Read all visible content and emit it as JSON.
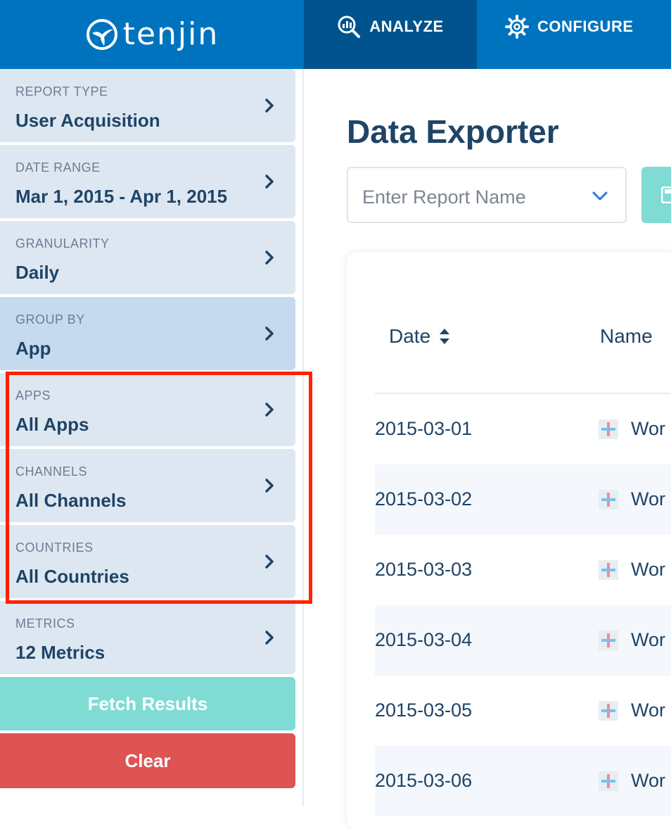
{
  "header": {
    "brand": "tenjin",
    "tabs": [
      {
        "label": "ANALYZE",
        "icon": "analyze-icon",
        "active": true
      },
      {
        "label": "CONFIGURE",
        "icon": "gear-icon",
        "active": false
      }
    ]
  },
  "sidebar": {
    "filters": [
      {
        "label": "REPORT TYPE",
        "value": "User Acquisition"
      },
      {
        "label": "DATE RANGE",
        "value": "Mar 1, 2015 - Apr 1, 2015"
      },
      {
        "label": "GRANULARITY",
        "value": "Daily"
      },
      {
        "label": "GROUP BY",
        "value": "App"
      },
      {
        "label": "APPS",
        "value": "All Apps"
      },
      {
        "label": "CHANNELS",
        "value": "All Channels"
      },
      {
        "label": "COUNTRIES",
        "value": "All Countries"
      },
      {
        "label": "METRICS",
        "value": "12 Metrics"
      }
    ],
    "fetch_label": "Fetch Results",
    "clear_label": "Clear"
  },
  "main": {
    "title": "Data Exporter",
    "report_name_placeholder": "Enter Report Name",
    "table": {
      "columns": [
        "Date",
        "Name"
      ],
      "rows": [
        {
          "date": "2015-03-01",
          "name": "Wor"
        },
        {
          "date": "2015-03-02",
          "name": "Wor"
        },
        {
          "date": "2015-03-03",
          "name": "Wor"
        },
        {
          "date": "2015-03-04",
          "name": "Wor"
        },
        {
          "date": "2015-03-05",
          "name": "Wor"
        },
        {
          "date": "2015-03-06",
          "name": "Wor"
        }
      ]
    }
  },
  "colors": {
    "header": "#0073bf",
    "active_tab": "#00538d",
    "filter_bg": "#dde7f2",
    "filter_active_bg": "#c5daee",
    "fetch": "#80dbd5",
    "clear": "#dd5452",
    "highlight": "#ff2200"
  }
}
